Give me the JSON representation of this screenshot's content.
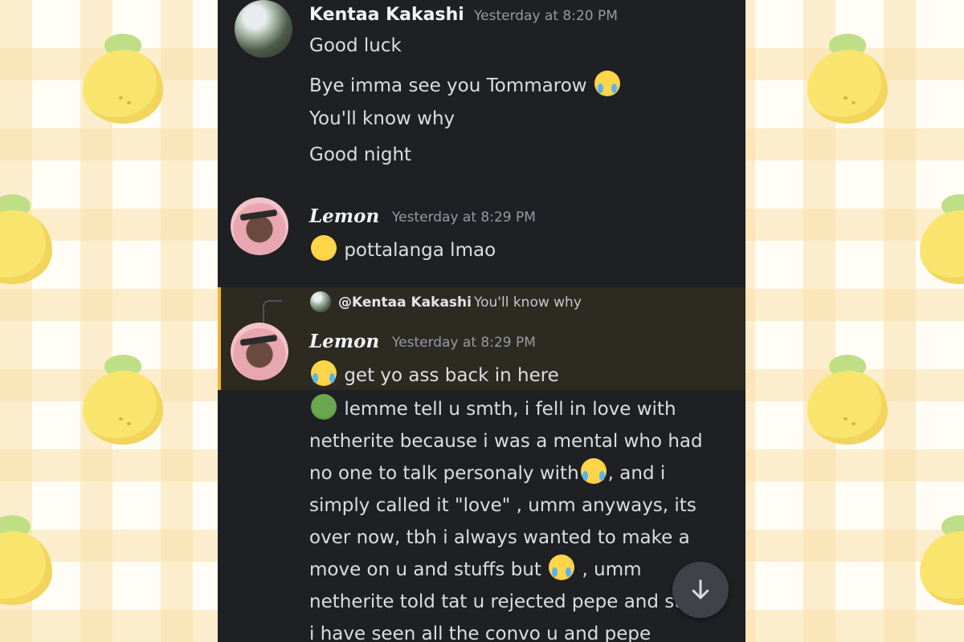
{
  "messages": [
    {
      "author": "Kentaa Kakashi",
      "timestamp": "Yesterday at 8:20 PM",
      "lines": [
        "Good luck",
        "Bye imma see you Tommarow",
        "You'll know why",
        "Good night"
      ]
    },
    {
      "author": "Lemon",
      "timestamp": "Yesterday at 8:29 PM",
      "lines": [
        "pottalanga lmao"
      ]
    },
    {
      "reply": {
        "author": "@Kentaa Kakashi",
        "text": "You'll know why"
      },
      "author": "Lemon",
      "timestamp": "Yesterday at 8:29 PM",
      "lines": [
        "get yo ass back in here"
      ],
      "long_text": {
        "part1": "lemme tell u smth, i fell in love with netherite because i was a mental who had no one to talk personaly with",
        "part2": ", and i simply called it \"love\" , umm anyways, its over now, tbh i always wanted to make a move on u and stuffs but",
        "part3": " , umm netherite told tat u rejected pepe and stuffs, i have seen all the convo u and pepe"
      }
    }
  ],
  "icons": {
    "scroll_down": "arrow-down-icon",
    "emojis": [
      "loudly-crying-face",
      "face-with-hand-over-mouth",
      "face-with-tears-of-joy",
      "pepe-emoji"
    ]
  },
  "colors": {
    "panel_bg": "#1f2024",
    "reply_highlight": "#2d2a22",
    "reply_bar": "#f0b232",
    "timestamp": "#949ba4"
  }
}
